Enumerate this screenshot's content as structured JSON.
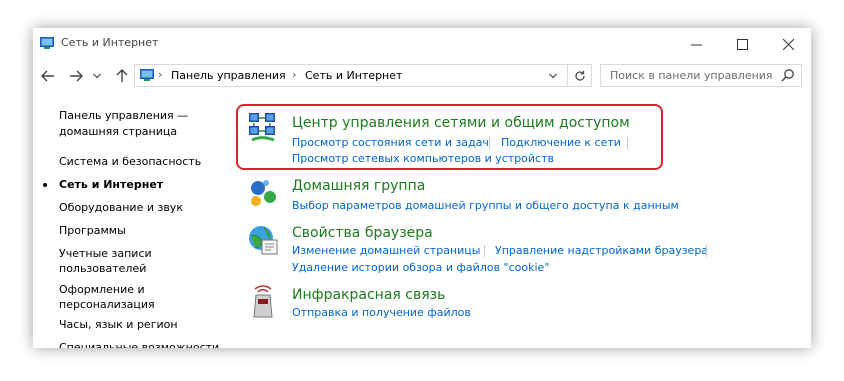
{
  "window": {
    "title": "Сеть и Интернет",
    "controls": {
      "minimize": "minimize",
      "maximize": "maximize",
      "close": "close"
    }
  },
  "address_bar": {
    "breadcrumbs": [
      "Панель управления",
      "Сеть и Интернет"
    ],
    "search_placeholder": "Поиск в панели управления"
  },
  "sidebar": {
    "items": [
      {
        "label": "Панель управления —\nдомашняя страница",
        "current": false
      },
      {
        "label": "Система и безопасность",
        "current": false
      },
      {
        "label": "Сеть и Интернет",
        "current": true
      },
      {
        "label": "Оборудование и звук",
        "current": false
      },
      {
        "label": "Программы",
        "current": false
      },
      {
        "label": "Учетные записи\nпользователей",
        "current": false
      },
      {
        "label": "Оформление и\nперсонализация",
        "current": false
      },
      {
        "label": "Часы, язык и регион",
        "current": false
      },
      {
        "label": "Специальные возможности",
        "current": false
      }
    ]
  },
  "categories": [
    {
      "title": "Центр управления сетями и общим доступом",
      "icon": "network-center-icon",
      "highlighted": true,
      "links": [
        "Просмотр состояния сети и задач",
        "Подключение к сети",
        "Просмотр сетевых компьютеров и устройств"
      ]
    },
    {
      "title": "Домашняя группа",
      "icon": "homegroup-icon",
      "links": [
        "Выбор параметров домашней группы и общего доступа к данным"
      ]
    },
    {
      "title": "Свойства браузера",
      "icon": "browser-properties-icon",
      "links": [
        "Изменение домашней страницы",
        "Управление надстройками браузера",
        "Удаление истории обзора и файлов \"cookie\""
      ]
    },
    {
      "title": "Инфракрасная связь",
      "icon": "infrared-icon",
      "links": [
        "Отправка и получение файлов"
      ]
    }
  ],
  "colors": {
    "link": "#0066cc",
    "category_title": "#1e7b1e",
    "highlight_border": "#d8262e"
  }
}
